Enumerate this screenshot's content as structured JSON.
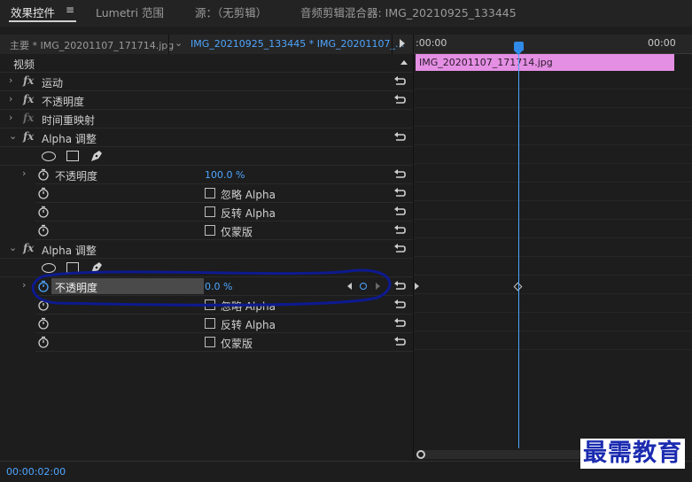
{
  "panel_tabs": {
    "effects_controls": "效果控件",
    "menu_glyph": "≡",
    "lumetri_scopes": "Lumetri 范围",
    "source": "源：（无剪辑）",
    "audio_mixer": "音频剪辑混合器: IMG_20210925_133445"
  },
  "sequence_tabs": {
    "master": "主要 * IMG_20201107_171714.jpg",
    "active": "IMG_20210925_133445 * IMG_20201107_..."
  },
  "section_header": "视频",
  "effects": {
    "motion": "运动",
    "opacity": "不透明度",
    "time_remap": "时间重映射",
    "alpha_adjust_1": "Alpha 调整",
    "alpha_adjust_2": "Alpha 调整"
  },
  "alpha_props": {
    "opacity_label": "不透明度",
    "opacity_value_1": "100.0 %",
    "opacity_value_2": "0.0 %",
    "ignore_alpha": "忽略 Alpha",
    "invert_alpha": "反转 Alpha",
    "mask_only": "仅蒙版"
  },
  "timeline": {
    "start_time": ":00:00",
    "end_time": "00:00",
    "clip_name": "IMG_20201107_171714.jpg"
  },
  "current_timecode": "00:00:02:00",
  "watermark": "最需教育",
  "colors": {
    "accent_blue": "#4ea6ff",
    "clip_pink": "#e48fe4",
    "annotation_navy": "#0d1a8f"
  }
}
